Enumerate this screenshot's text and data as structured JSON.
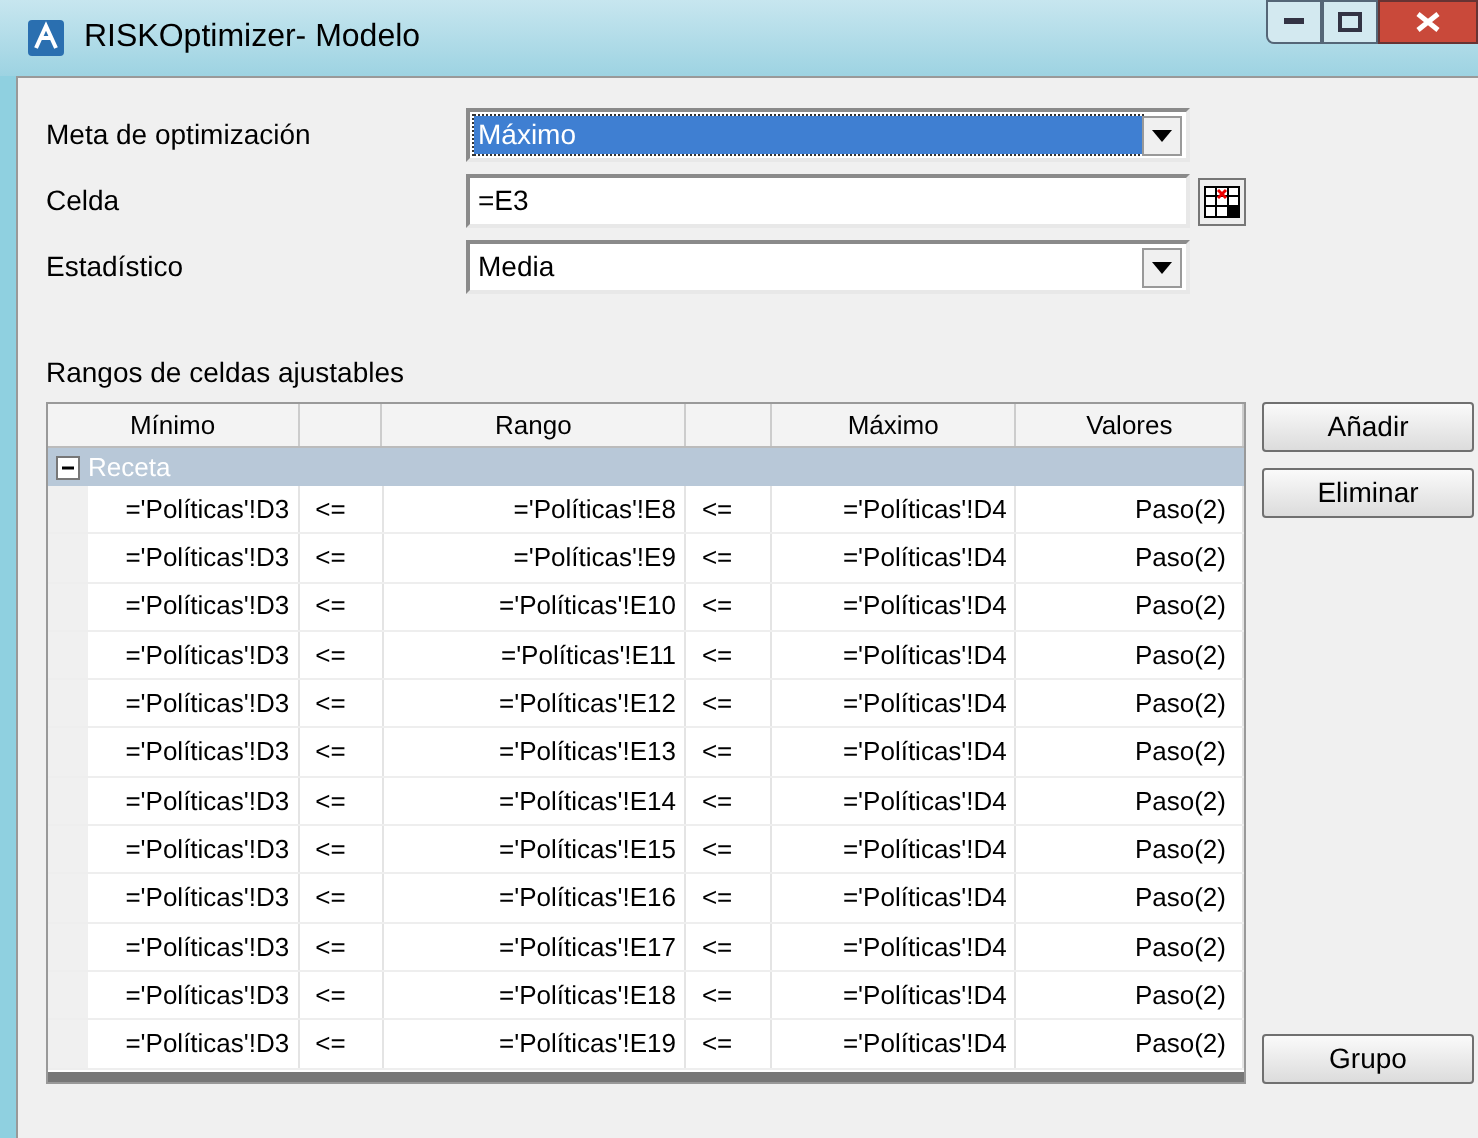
{
  "window": {
    "title": "RISKOptimizer- Modelo"
  },
  "fields": [
    {
      "kind": "dropdown",
      "label": "Meta de optimización",
      "value": "Máximo",
      "selected": true
    },
    {
      "kind": "cell",
      "label": "Celda",
      "value": "=E3",
      "selected": false
    },
    {
      "kind": "dropdown",
      "label": "Estadístico",
      "value": "Media",
      "selected": false
    }
  ],
  "ranges": {
    "title": "Rangos de celdas ajustables",
    "columns": [
      "Mínimo",
      "",
      "Rango",
      "",
      "Máximo",
      "Valores"
    ],
    "group": {
      "name": "Receta",
      "expanded": true
    },
    "rows": [
      [
        "='Políticas'!D3",
        "<=",
        "='Políticas'!E8",
        "<=",
        "='Políticas'!D4",
        "Paso(2)"
      ],
      [
        "='Políticas'!D3",
        "<=",
        "='Políticas'!E9",
        "<=",
        "='Políticas'!D4",
        "Paso(2)"
      ],
      [
        "='Políticas'!D3",
        "<=",
        "='Políticas'!E10",
        "<=",
        "='Políticas'!D4",
        "Paso(2)"
      ],
      [
        "='Políticas'!D3",
        "<=",
        "='Políticas'!E11",
        "<=",
        "='Políticas'!D4",
        "Paso(2)"
      ],
      [
        "='Políticas'!D3",
        "<=",
        "='Políticas'!E12",
        "<=",
        "='Políticas'!D4",
        "Paso(2)"
      ],
      [
        "='Políticas'!D3",
        "<=",
        "='Políticas'!E13",
        "<=",
        "='Políticas'!D4",
        "Paso(2)"
      ],
      [
        "='Políticas'!D3",
        "<=",
        "='Políticas'!E14",
        "<=",
        "='Políticas'!D4",
        "Paso(2)"
      ],
      [
        "='Políticas'!D3",
        "<=",
        "='Políticas'!E15",
        "<=",
        "='Políticas'!D4",
        "Paso(2)"
      ],
      [
        "='Políticas'!D3",
        "<=",
        "='Políticas'!E16",
        "<=",
        "='Políticas'!D4",
        "Paso(2)"
      ],
      [
        "='Políticas'!D3",
        "<=",
        "='Políticas'!E17",
        "<=",
        "='Políticas'!D4",
        "Paso(2)"
      ],
      [
        "='Políticas'!D3",
        "<=",
        "='Políticas'!E18",
        "<=",
        "='Políticas'!D4",
        "Paso(2)"
      ],
      [
        "='Políticas'!D3",
        "<=",
        "='Políticas'!E19",
        "<=",
        "='Políticas'!D4",
        "Paso(2)"
      ]
    ]
  },
  "buttons": {
    "side": [
      "Añadir",
      "Eliminar"
    ],
    "bottom": "Grupo"
  }
}
